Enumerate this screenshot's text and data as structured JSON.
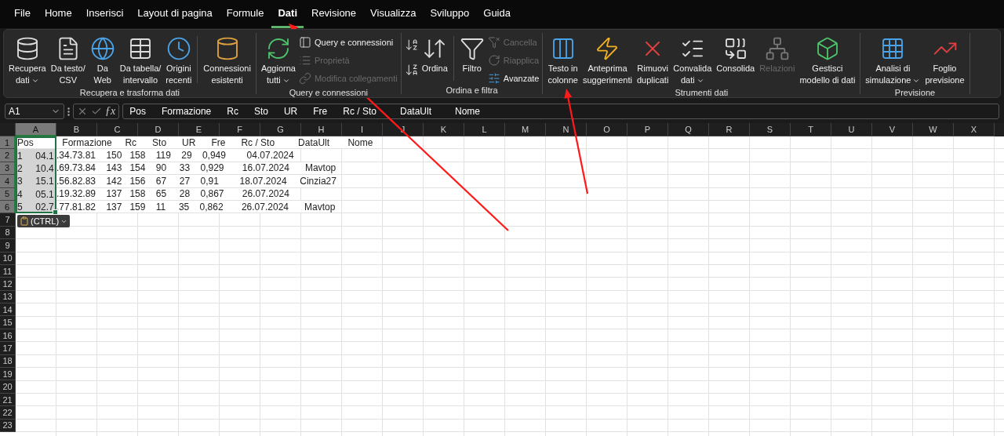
{
  "menu": [
    {
      "label": "File",
      "selected": false
    },
    {
      "label": "Home",
      "selected": false
    },
    {
      "label": "Inserisci",
      "selected": false
    },
    {
      "label": "Layout di pagina",
      "selected": false
    },
    {
      "label": "Formule",
      "selected": false
    },
    {
      "label": "Dati",
      "selected": true
    },
    {
      "label": "Revisione",
      "selected": false
    },
    {
      "label": "Visualizza",
      "selected": false
    },
    {
      "label": "Sviluppo",
      "selected": false
    },
    {
      "label": "Guida",
      "selected": false
    }
  ],
  "ribbon": {
    "groups": [
      {
        "label": "Recupera e trasforma dati",
        "items": [
          {
            "kind": "large",
            "lines": [
              "Recupera",
              "dati"
            ],
            "dropdown": true,
            "disabled": false
          },
          {
            "kind": "large",
            "lines": [
              "Da testo/",
              "CSV"
            ],
            "dropdown": false,
            "disabled": false
          },
          {
            "kind": "large",
            "lines": [
              "Da",
              "Web"
            ],
            "dropdown": false,
            "disabled": false
          },
          {
            "kind": "large",
            "lines": [
              "Da tabella/",
              "intervallo"
            ],
            "dropdown": false,
            "disabled": false
          },
          {
            "kind": "large",
            "lines": [
              "Origini",
              "recenti"
            ],
            "dropdown": false,
            "disabled": false
          },
          {
            "kind": "separator"
          },
          {
            "kind": "large",
            "lines": [
              "Connessioni",
              "esistenti"
            ],
            "dropdown": false,
            "disabled": false
          }
        ]
      },
      {
        "label": "Query e connessioni",
        "items": [
          {
            "kind": "large",
            "lines": [
              "Aggiorna",
              "tutti"
            ],
            "dropdown": true,
            "disabled": false
          },
          {
            "kind": "stack",
            "items": [
              {
                "label": "Query e connessioni",
                "disabled": false
              },
              {
                "label": "Proprietà",
                "disabled": true
              },
              {
                "label": "Modifica collegamenti",
                "disabled": true
              }
            ]
          }
        ]
      },
      {
        "label": "Ordina e filtra",
        "items": [
          {
            "kind": "iconstack"
          },
          {
            "kind": "large",
            "lines": [
              "Ordina"
            ],
            "dropdown": false,
            "disabled": false
          },
          {
            "kind": "separator"
          },
          {
            "kind": "large",
            "lines": [
              "Filtro"
            ],
            "dropdown": false,
            "disabled": false
          },
          {
            "kind": "stack",
            "items": [
              {
                "label": "Cancella",
                "disabled": true
              },
              {
                "label": "Riapplica",
                "disabled": true
              },
              {
                "label": "Avanzate",
                "disabled": false
              }
            ]
          }
        ]
      },
      {
        "label": "Strumenti dati",
        "items": [
          {
            "kind": "large",
            "lines": [
              "Testo in",
              "colonne"
            ],
            "dropdown": false,
            "disabled": false
          },
          {
            "kind": "large",
            "lines": [
              "Anteprima",
              "suggerimenti"
            ],
            "dropdown": false,
            "disabled": false
          },
          {
            "kind": "large",
            "lines": [
              "Rimuovi",
              "duplicati"
            ],
            "dropdown": false,
            "disabled": false
          },
          {
            "kind": "large",
            "lines": [
              "Convalida",
              "dati"
            ],
            "dropdown": true,
            "disabled": false
          },
          {
            "kind": "large",
            "lines": [
              "Consolida"
            ],
            "dropdown": false,
            "disabled": false
          },
          {
            "kind": "large",
            "lines": [
              "Relazioni"
            ],
            "dropdown": false,
            "disabled": true
          },
          {
            "kind": "large",
            "lines": [
              "Gestisci",
              "modello di dati"
            ],
            "dropdown": false,
            "disabled": false
          }
        ]
      },
      {
        "label": "Previsione",
        "items": [
          {
            "kind": "large",
            "lines": [
              "Analisi di",
              "simulazione"
            ],
            "dropdown": true,
            "disabled": false
          },
          {
            "kind": "large",
            "lines": [
              "Foglio",
              "previsione"
            ],
            "dropdown": false,
            "disabled": false
          }
        ]
      }
    ]
  },
  "formula_bar": {
    "name_box": "A1",
    "fx": "ƒx",
    "content": "Pos      Formazione      Rc      Sto      UR      Fre      Rc / Sto         DataUlt         Nome"
  },
  "sheet": {
    "columns": [
      {
        "label": "A",
        "selected": true
      },
      {
        "label": "B",
        "selected": false
      },
      {
        "label": "C",
        "selected": false
      },
      {
        "label": "D",
        "selected": false
      },
      {
        "label": "E",
        "selected": false
      },
      {
        "label": "F",
        "selected": false
      },
      {
        "label": "G",
        "selected": false
      },
      {
        "label": "H",
        "selected": false
      },
      {
        "label": "I",
        "selected": false
      },
      {
        "label": "J",
        "selected": false
      },
      {
        "label": "K",
        "selected": false
      },
      {
        "label": "L",
        "selected": false
      },
      {
        "label": "M",
        "selected": false
      },
      {
        "label": "N",
        "selected": false
      },
      {
        "label": "O",
        "selected": false
      },
      {
        "label": "P",
        "selected": false
      },
      {
        "label": "Q",
        "selected": false
      },
      {
        "label": "R",
        "selected": false
      },
      {
        "label": "S",
        "selected": false
      },
      {
        "label": "T",
        "selected": false
      },
      {
        "label": "U",
        "selected": false
      },
      {
        "label": "V",
        "selected": false
      },
      {
        "label": "W",
        "selected": false
      },
      {
        "label": "X",
        "selected": false
      }
    ],
    "rows": [
      {
        "label": "1",
        "selected": true,
        "cell_a": "Pos           Formazione     Rc      Sto      UR      Fre      Rc / Sto         DataUlt       Nome"
      },
      {
        "label": "2",
        "selected": true,
        "cell_a": "1     04.1",
        "overflow": ".34.73.81    150   158    119    29    0,949        04.07.2024"
      },
      {
        "label": "3",
        "selected": true,
        "cell_a": "2     10.4",
        "overflow": ".69.73.84    143   154    90     33    0,929       16.07.2024      Mavtop"
      },
      {
        "label": "4",
        "selected": true,
        "cell_a": "3     15.1",
        "overflow": ".56.82.83    142   156    67     27    0,91        18.07.2024     Cinzia27"
      },
      {
        "label": "5",
        "selected": true,
        "cell_a": "4     05.1",
        "overflow": ".19.32.89    137   158    65     28    0,867       26.07.2024"
      },
      {
        "label": "6",
        "selected": true,
        "cell_a": "5     02.7",
        "overflow": ".77.81.82    137   159    11     35    0,862       26.07.2024      Mavtop"
      },
      {
        "label": "7",
        "selected": false
      },
      {
        "label": "8",
        "selected": false
      },
      {
        "label": "9",
        "selected": false
      },
      {
        "label": "10",
        "selected": false
      },
      {
        "label": "11",
        "selected": false
      },
      {
        "label": "12",
        "selected": false
      },
      {
        "label": "13",
        "selected": false
      },
      {
        "label": "14",
        "selected": false
      },
      {
        "label": "15",
        "selected": false
      },
      {
        "label": "16",
        "selected": false
      },
      {
        "label": "17",
        "selected": false
      },
      {
        "label": "18",
        "selected": false
      },
      {
        "label": "19",
        "selected": false
      },
      {
        "label": "20",
        "selected": false
      },
      {
        "label": "21",
        "selected": false
      },
      {
        "label": "22",
        "selected": false
      },
      {
        "label": "23",
        "selected": false
      }
    ]
  },
  "paste_options": {
    "label": "(CTRL)"
  }
}
